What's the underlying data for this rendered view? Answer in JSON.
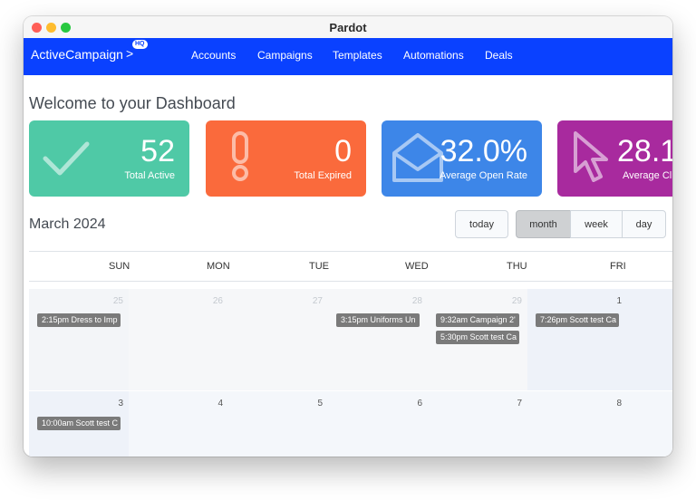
{
  "window": {
    "title": "Pardot"
  },
  "nav": {
    "brand": "ActiveCampaign",
    "brand_arrow": ">",
    "badge": "HQ",
    "items": [
      "Accounts",
      "Campaigns",
      "Templates",
      "Automations",
      "Deals"
    ]
  },
  "welcome": "Welcome to your Dashboard",
  "stats": [
    {
      "value": "52",
      "label": "Total Active",
      "color": "#4fc9a6",
      "icon": "checkmark-icon"
    },
    {
      "value": "0",
      "label": "Total Expired",
      "color": "#fa6a3c",
      "icon": "exclamation-icon"
    },
    {
      "value": "32.0%",
      "label": "Average Open Rate",
      "color": "#3d86e8",
      "icon": "open-envelope-icon"
    },
    {
      "value": "28.1",
      "label": "Average Cli",
      "color": "#a82a9e",
      "icon": "cursor-pointer-icon"
    }
  ],
  "calendar": {
    "title": "March 2024",
    "buttons": {
      "today": "today",
      "month": "month",
      "week": "week",
      "day": "day"
    },
    "days": [
      "SUN",
      "MON",
      "TUE",
      "WED",
      "THU",
      "FRI"
    ],
    "weeks": [
      {
        "dates": [
          "25",
          "26",
          "27",
          "28",
          "29",
          "1"
        ]
      },
      {
        "dates": [
          "3",
          "4",
          "5",
          "6",
          "7",
          "8"
        ]
      }
    ],
    "events": {
      "w0_sun": "2:15pm Dress to Imp",
      "w0_wed": "3:15pm Uniforms Un",
      "w0_thu_1": "9:32am Campaign 2'",
      "w0_thu_2": "5:30pm Scott test Ca",
      "w0_fri": "7:26pm Scott test Ca",
      "w1_sun": "10:00am Scott test C"
    }
  }
}
